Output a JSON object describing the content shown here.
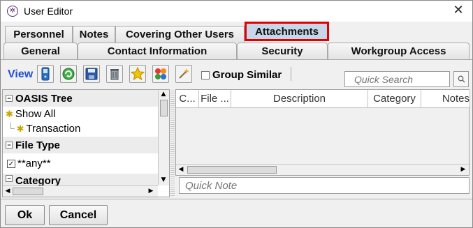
{
  "window": {
    "title": "User Editor",
    "close_glyph": "✕"
  },
  "tabs_row1": [
    "Personnel",
    "Notes",
    "Covering Other Users",
    "Attachments"
  ],
  "selected_tab": "Attachments",
  "tabs_row2": [
    "General",
    "Contact Information",
    "Security",
    "Workgroup Access"
  ],
  "toolbar": {
    "view_label": "View",
    "buttons": [
      "phone-icon",
      "refresh-icon",
      "save-icon",
      "trash-icon",
      "star-icon",
      "people-icon",
      "wand-icon"
    ],
    "group_similar_label": "Group Similar",
    "search_placeholder": "Quick Search"
  },
  "left_panel": {
    "oasis_tree_header": "OASIS Tree",
    "show_all": "Show All",
    "transaction": "Transaction",
    "file_type_header": "File Type",
    "any_item": "**any**",
    "category_header": "Category"
  },
  "table": {
    "columns": [
      "C...",
      "File ...",
      "Description",
      "Category",
      "Notes"
    ]
  },
  "quick_note_placeholder": "Quick Note",
  "footer": {
    "ok_label": "Ok",
    "cancel_label": "Cancel"
  },
  "colors": {
    "accent_blue": "#1e50d2",
    "highlight_red": "#e00000",
    "selected_tab_bg": "#c8d6ea"
  }
}
